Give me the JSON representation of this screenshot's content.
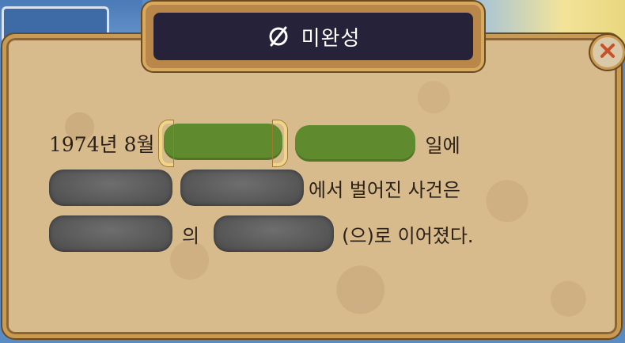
{
  "header": {
    "status_title": "미완성",
    "status_icon": "empty-set-icon"
  },
  "close": {
    "icon": "close-x-icon",
    "color": "#c8502a"
  },
  "sentence": {
    "line1": {
      "prefix": "1974년 8월",
      "suffix": "일에"
    },
    "line2": {
      "suffix": "에서 벌어진 사건은"
    },
    "line3": {
      "middle": "의",
      "suffix": "(으)로 이어졌다."
    }
  },
  "blanks": [
    {
      "id": "blank-1",
      "state": "selected",
      "color": "#5f8a2e"
    },
    {
      "id": "blank-2",
      "state": "filled",
      "color": "#5f8a2e"
    },
    {
      "id": "blank-3",
      "state": "empty",
      "color": "#5a5a5a"
    },
    {
      "id": "blank-4",
      "state": "empty",
      "color": "#5a5a5a"
    },
    {
      "id": "blank-5",
      "state": "empty",
      "color": "#5a5a5a"
    },
    {
      "id": "blank-6",
      "state": "empty",
      "color": "#5a5a5a"
    }
  ]
}
